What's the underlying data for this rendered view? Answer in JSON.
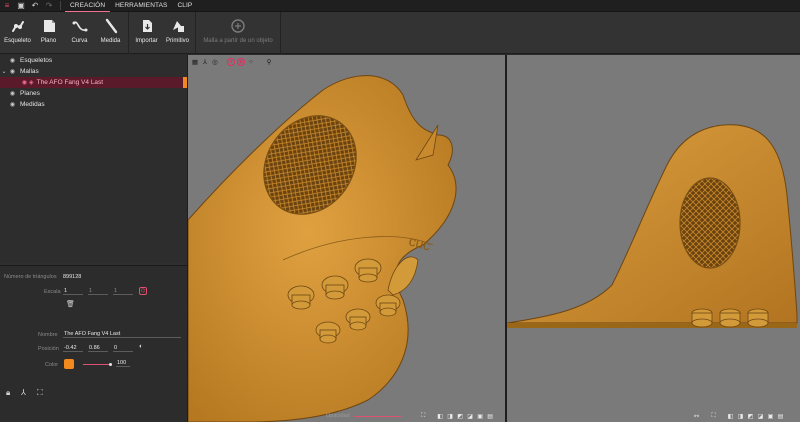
{
  "menubar": {
    "tabs": [
      {
        "label": "CREACIÓN",
        "active": true
      },
      {
        "label": "HERRAMIENTAS",
        "active": false
      },
      {
        "label": "CLIP",
        "active": false
      }
    ]
  },
  "ribbon": {
    "group1": [
      {
        "label": "Esqueleto",
        "icon": "skeleton-icon"
      },
      {
        "label": "Plano",
        "icon": "plane-icon"
      },
      {
        "label": "Curva",
        "icon": "curve-icon"
      },
      {
        "label": "Medida",
        "icon": "measure-icon"
      }
    ],
    "group2": [
      {
        "label": "Importar",
        "icon": "import-icon"
      },
      {
        "label": "Primitivo",
        "icon": "primitive-icon"
      }
    ],
    "group3": [
      {
        "label": "Malla a partir de un objeto",
        "icon": "mesh-from-object-icon",
        "disabled": true
      }
    ]
  },
  "tree": {
    "items": [
      {
        "label": "Esqueletos"
      },
      {
        "label": "Mallas"
      },
      {
        "label": "The AFO Fang V4 Last"
      },
      {
        "label": "Planes"
      },
      {
        "label": "Medidas"
      }
    ]
  },
  "props": {
    "triangles_label": "Número de triángulos",
    "triangles_value": "899128",
    "scale_label": "Escala",
    "scale_x": "1",
    "scale_y": "1",
    "scale_z": "1",
    "name_label": "Nombre",
    "name_value": "The AFO Fang V4 Last",
    "position_label": "Posición",
    "pos_x": "-0.42",
    "pos_y": "0.86",
    "pos_z": "0",
    "color_label": "Color",
    "color_hex": "#f28a1e",
    "color_value": "100"
  },
  "viewport": {
    "opacity_label": "Opacidad"
  },
  "colors": {
    "accent": "#e05070",
    "selection_bar": "#f08a1e",
    "model": "#c98a2e",
    "viewport_bg": "#7a7a7a"
  }
}
